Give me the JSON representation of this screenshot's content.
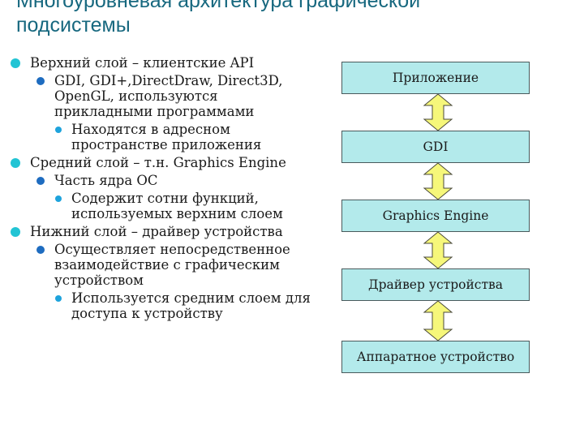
{
  "slide": {
    "title": "Многоуровневая архитектура графической подсистемы",
    "bullets": [
      {
        "level": 1,
        "text": "Верхний слой – клиентские API"
      },
      {
        "level": 2,
        "text": "GDI, GDI+,DirectDraw, Direct3D, OpenGL, используются прикладными программами"
      },
      {
        "level": 3,
        "text": "Находятся в адресном пространстве приложения"
      },
      {
        "level": 1,
        "text": "Средний слой – т.н. Graphics Engine"
      },
      {
        "level": 2,
        "text": "Часть ядра ОС"
      },
      {
        "level": 3,
        "text": "Содержит сотни функций, используемых верхним слоем"
      },
      {
        "level": 1,
        "text": "Нижний слой – драйвер устройства"
      },
      {
        "level": 2,
        "text": "Осуществляет непосредственное взаимодействие с графическим устройством"
      },
      {
        "level": 3,
        "text": "Используется средним слоем для доступа к устройству"
      }
    ]
  },
  "diagram": {
    "layers": [
      {
        "label": "Приложение"
      },
      {
        "label": "GDI"
      },
      {
        "label": "Graphics Engine"
      },
      {
        "label": "Драйвер устройства"
      },
      {
        "label": "Аппаратное устройство"
      }
    ],
    "connector": "bidirectional-arrow",
    "colors": {
      "box_fill": "#b3eaeb",
      "box_border": "#4a5a5c",
      "arrow_fill": "#f6f77a",
      "arrow_stroke": "#4a4a3a"
    }
  },
  "colors": {
    "title": "#17687f",
    "bullet_level1": "#22c4d4",
    "bullet_level2": "#1e6cc0",
    "bullet_level3": "#1ea3dc"
  }
}
